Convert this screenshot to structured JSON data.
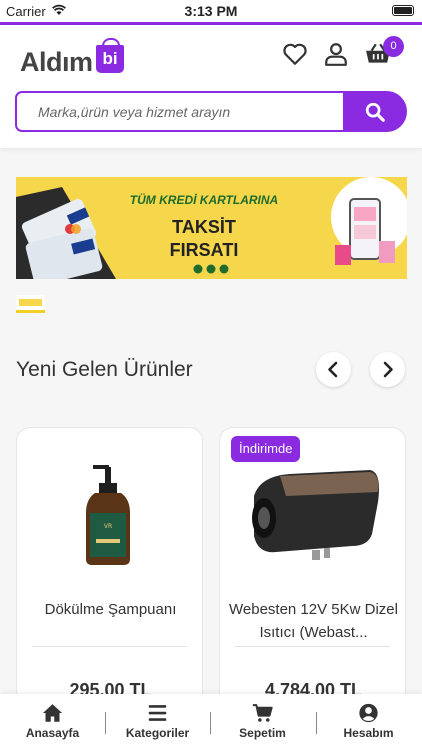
{
  "status_bar": {
    "carrier": "Carrier",
    "time": "3:13 PM"
  },
  "header": {
    "logo_text": "Aldım",
    "logo_badge": "bi",
    "cart_count": "0",
    "icons": [
      "heart-icon",
      "user-icon",
      "basket-icon"
    ]
  },
  "search": {
    "placeholder": "Marka,ürün veya hizmet arayın"
  },
  "banner": {
    "line1": "TÜM KREDİ KARTLARINA",
    "line2": "TAKSİT",
    "line3": "FIRSATI"
  },
  "section": {
    "title": "Yeni Gelen Ürünler"
  },
  "products": [
    {
      "name": "Dökülme Şampuanı",
      "price": "295,00 TL",
      "badge": ""
    },
    {
      "name": "Webesten 12V 5Kw Dizel Isıtıcı (Webast...",
      "price": "4.784,00 TL",
      "badge": "İndirimde"
    }
  ],
  "tabs": [
    {
      "label": "Anasayfa",
      "icon": "home-icon"
    },
    {
      "label": "Kategoriler",
      "icon": "list-icon"
    },
    {
      "label": "Sepetim",
      "icon": "cart-icon"
    },
    {
      "label": "Hesabım",
      "icon": "account-icon"
    }
  ],
  "colors": {
    "accent": "#8a2be2",
    "banner": "#f6d64a",
    "banner_green": "#1e6b2c"
  }
}
